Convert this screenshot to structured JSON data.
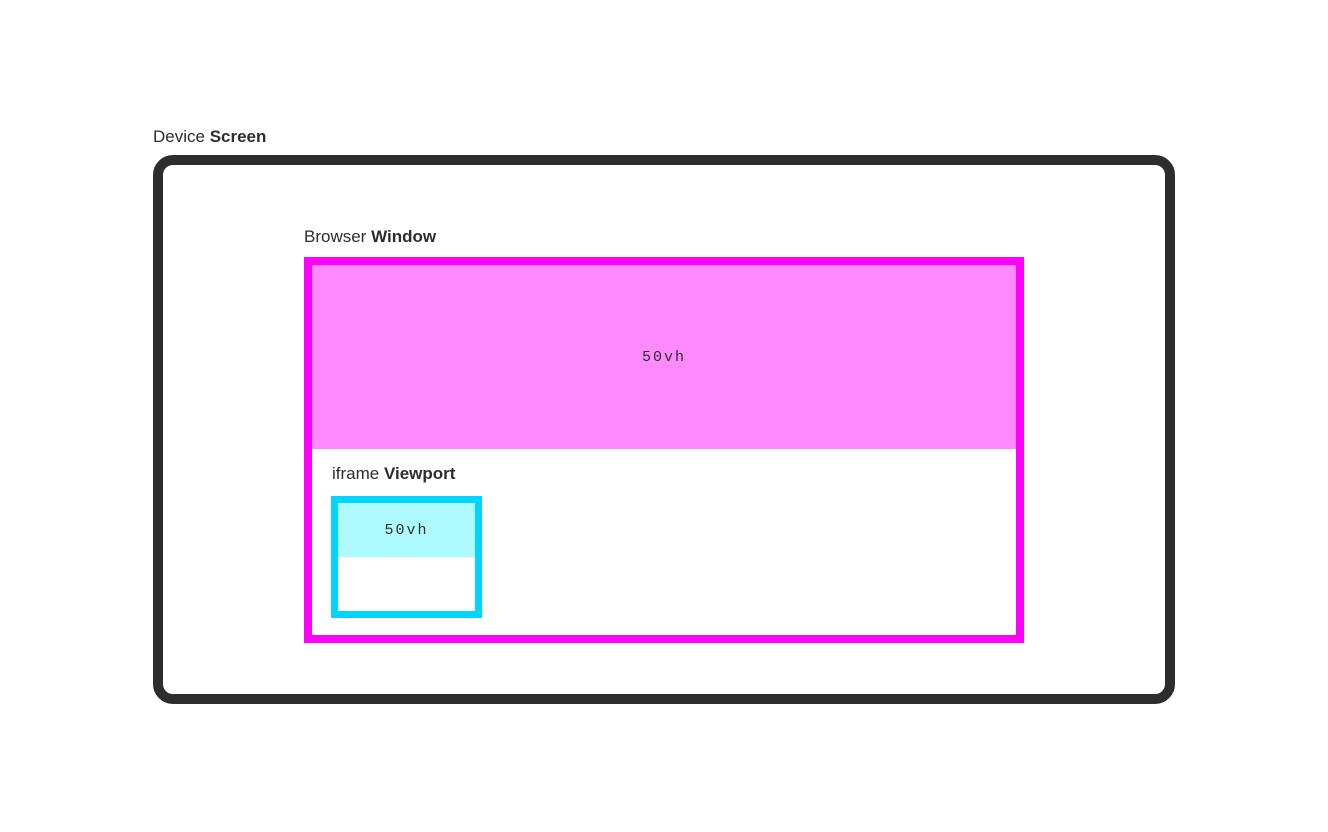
{
  "labels": {
    "screen_prefix": "Device ",
    "screen_bold": "Screen",
    "window_prefix": "Browser ",
    "window_bold": "Window",
    "viewport_prefix": "iframe ",
    "viewport_bold": "Viewport",
    "vh_large": "50vh",
    "vh_small": "50vh"
  },
  "colors": {
    "screen_border": "#2d2d2d",
    "window_border": "#ff00ff",
    "window_fill": "#ff8aff",
    "viewport_border": "#00d5ff",
    "viewport_fill": "#aefbff"
  }
}
